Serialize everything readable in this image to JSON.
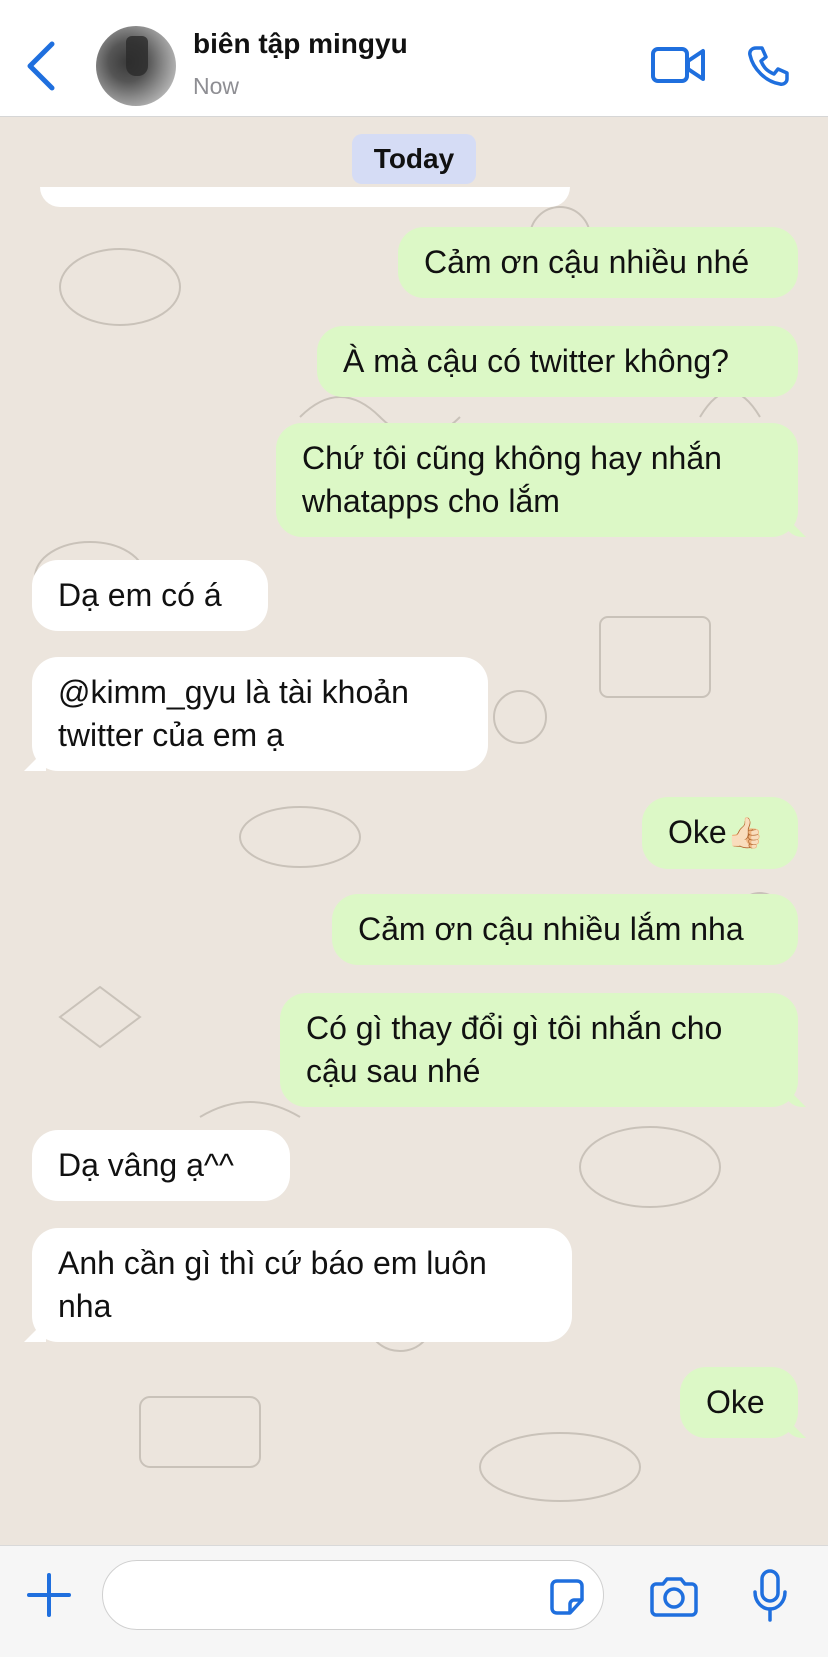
{
  "header": {
    "contact_name": "biên tập mingyu",
    "status": "Now",
    "accent_color": "#1f6fde"
  },
  "chat": {
    "date_label": "Today",
    "messages": [
      {
        "direction": "outgoing",
        "text": "Cảm ơn cậu nhiều nhé"
      },
      {
        "direction": "outgoing",
        "text": "À mà cậu có twitter không?"
      },
      {
        "direction": "outgoing",
        "text": "Chứ tôi cũng không hay nhắn whatapps cho lắm"
      },
      {
        "direction": "incoming",
        "text": "Dạ em có á"
      },
      {
        "direction": "incoming",
        "text": "@kimm_gyu là tài khoản twitter của em ạ"
      },
      {
        "direction": "outgoing",
        "text": "Oke",
        "emoji": "👍🏻"
      },
      {
        "direction": "outgoing",
        "text": "Cảm ơn cậu nhiều lắm nha"
      },
      {
        "direction": "outgoing",
        "text": "Có gì thay đổi gì tôi nhắn cho cậu sau nhé"
      },
      {
        "direction": "incoming",
        "text": "Dạ vâng ạ^^"
      },
      {
        "direction": "incoming",
        "text": "Anh cần gì thì cứ báo em luôn nha"
      },
      {
        "direction": "outgoing",
        "text": "Oke"
      }
    ],
    "outgoing_bubble_color": "#dcf8c6",
    "incoming_bubble_color": "#ffffff"
  },
  "composer": {
    "input_value": "",
    "icons": [
      "plus-icon",
      "sticker-icon",
      "camera-icon",
      "microphone-icon"
    ]
  }
}
